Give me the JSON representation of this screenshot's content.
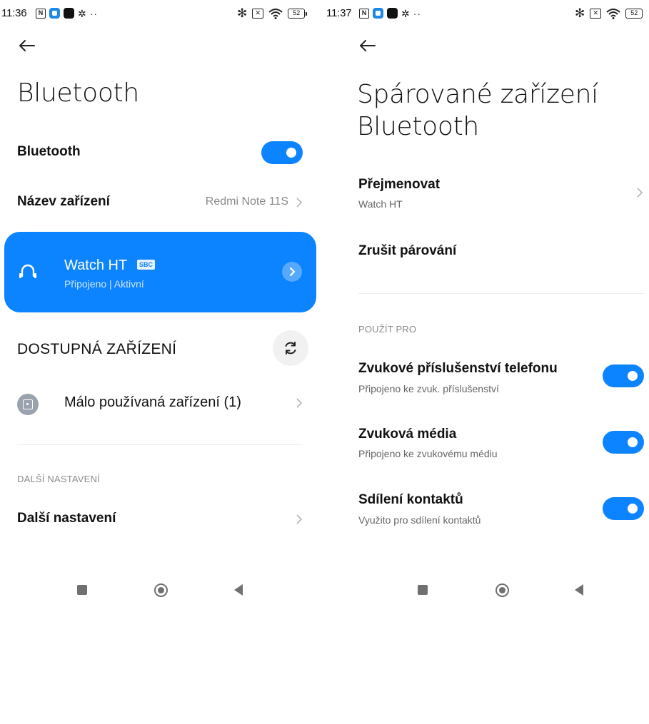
{
  "colors": {
    "accent": "#0d84ff",
    "text_primary": "#111111",
    "text_secondary": "#666666",
    "text_muted": "#8a8a8a",
    "divider": "#ececec"
  },
  "left_screen": {
    "status_bar": {
      "time": "11:36",
      "left_icons": [
        "nfc-icon",
        "app-notification-icon",
        "dark-app-notification-icon",
        "settings-gear-icon",
        "more-dots-icon"
      ],
      "right_icons": [
        "bluetooth-icon",
        "no-sim-icon",
        "wifi-icon"
      ],
      "battery": "52"
    },
    "title": "Bluetooth",
    "bluetooth_row": {
      "label": "Bluetooth",
      "toggle_on": true
    },
    "device_name_row": {
      "label": "Název zařízení",
      "value": "Redmi Note 11S"
    },
    "connected_device": {
      "name": "Watch HT",
      "codec": "SBC",
      "status": "Připojeno  | Aktivní",
      "icon": "headphones-icon"
    },
    "available_section": {
      "label": "DOSTUPNÁ ZAŘÍZENÍ",
      "refresh_icon": "refresh-icon"
    },
    "rarely_used_row": {
      "label": "Málo používaná zařízení (1)"
    },
    "more_settings_section": {
      "label": "DALŠÍ NASTAVENÍ"
    },
    "more_settings_row": {
      "label": "Další nastavení"
    }
  },
  "right_screen": {
    "status_bar": {
      "time": "11:37",
      "left_icons": [
        "nfc-icon",
        "app-notification-icon",
        "dark-app-notification-icon",
        "settings-gear-icon",
        "more-dots-icon"
      ],
      "right_icons": [
        "bluetooth-icon",
        "no-sim-icon",
        "wifi-icon"
      ],
      "battery": "52"
    },
    "title_line1": "Spárované zařízení",
    "title_line2": "Bluetooth",
    "rename_row": {
      "label": "Přejmenovat",
      "value": "Watch HT"
    },
    "unpair_row": {
      "label": "Zrušit párování"
    },
    "use_for_section": {
      "label": "POUŽÍT PRO"
    },
    "profiles": [
      {
        "label": "Zvukové příslušenství telefonu",
        "sub": "Připojeno ke zvuk. příslušenství",
        "toggle_on": true
      },
      {
        "label": "Zvuková média",
        "sub": "Připojeno ke zvukovému médiu",
        "toggle_on": true
      },
      {
        "label": "Sdílení kontaktů",
        "sub": "Využito pro sdílení kontaktů",
        "toggle_on": true
      }
    ]
  },
  "nav_bar": {
    "icons": [
      "recents-square-icon",
      "home-circle-icon",
      "back-triangle-icon"
    ]
  }
}
